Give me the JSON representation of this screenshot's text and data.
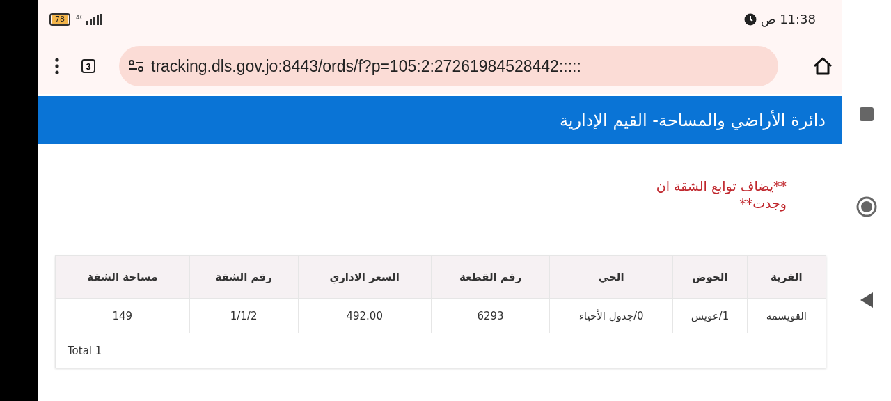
{
  "status_bar": {
    "battery": "78",
    "network": "4G",
    "time": "11:38 ص"
  },
  "browser": {
    "tab_count": "3",
    "url": "tracking.dls.gov.jo:8443/ords/f?p=105:2:27261984528442:::::"
  },
  "page_header": {
    "title": "دائرة الأراضي والمساحة- القيم الإدارية"
  },
  "note": "**يضاف توابع الشقة ان وجدت**",
  "table": {
    "columns": [
      "القرية",
      "الحوض",
      "الحي",
      "رقم القطعة",
      "السعر الاداري",
      "رقم الشقة",
      "مساحة الشقة"
    ],
    "rows": [
      [
        "القويسمه",
        "1/عويس",
        "0/جدول الأحياء",
        "6293",
        "492.00",
        "1/1/2",
        "149"
      ]
    ],
    "footer": "Total 1"
  }
}
